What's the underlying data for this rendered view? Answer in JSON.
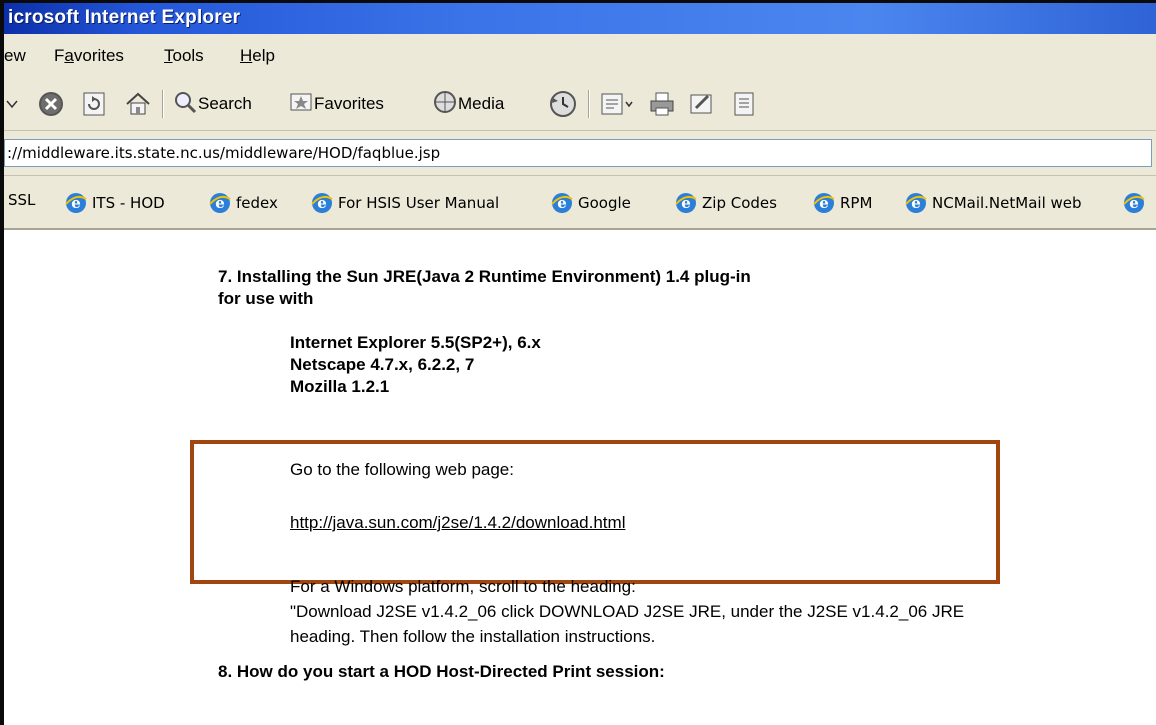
{
  "window": {
    "title": "icrosoft Internet Explorer"
  },
  "menu": {
    "items": [
      "ew",
      "Favorites",
      "Tools",
      "Help"
    ]
  },
  "toolbar": {
    "search_label": "Search",
    "favorites_label": "Favorites",
    "media_label": "Media"
  },
  "address": {
    "value": "://middleware.its.state.nc.us/middleware/HOD/faqblue.jsp"
  },
  "links": [
    "SSL",
    "ITS - HOD",
    "fedex",
    "For HSIS User Manual",
    "Google",
    "Zip Codes",
    "RPM",
    "NCMail.NetMail web"
  ],
  "content": {
    "q7_line1": "7. Installing the Sun JRE(Java 2 Runtime Environment) 1.4 plug-in",
    "q7_line2": "for use with",
    "browsers": [
      "Internet Explorer 5.5(SP2+), 6.x",
      "Netscape 4.7.x, 6.2.2, 7",
      "Mozilla 1.2.1"
    ],
    "goto": "Go to the following web page:",
    "url": "http://java.sun.com/j2se/1.4.2/download.html",
    "instructions": [
      "For a Windows platform, scroll to the heading:",
      "\"Download J2SE v1.4.2_06 click DOWNLOAD J2SE JRE, under the J2SE v1.4.2_06 JRE",
      "heading. Then follow the installation instructions."
    ],
    "q8": "8. How do you start a HOD Host-Directed Print session:"
  },
  "colors": {
    "highlight_border": "#a1460f",
    "titlebar": "#2457d8",
    "chrome_bg": "#ece9d8"
  }
}
